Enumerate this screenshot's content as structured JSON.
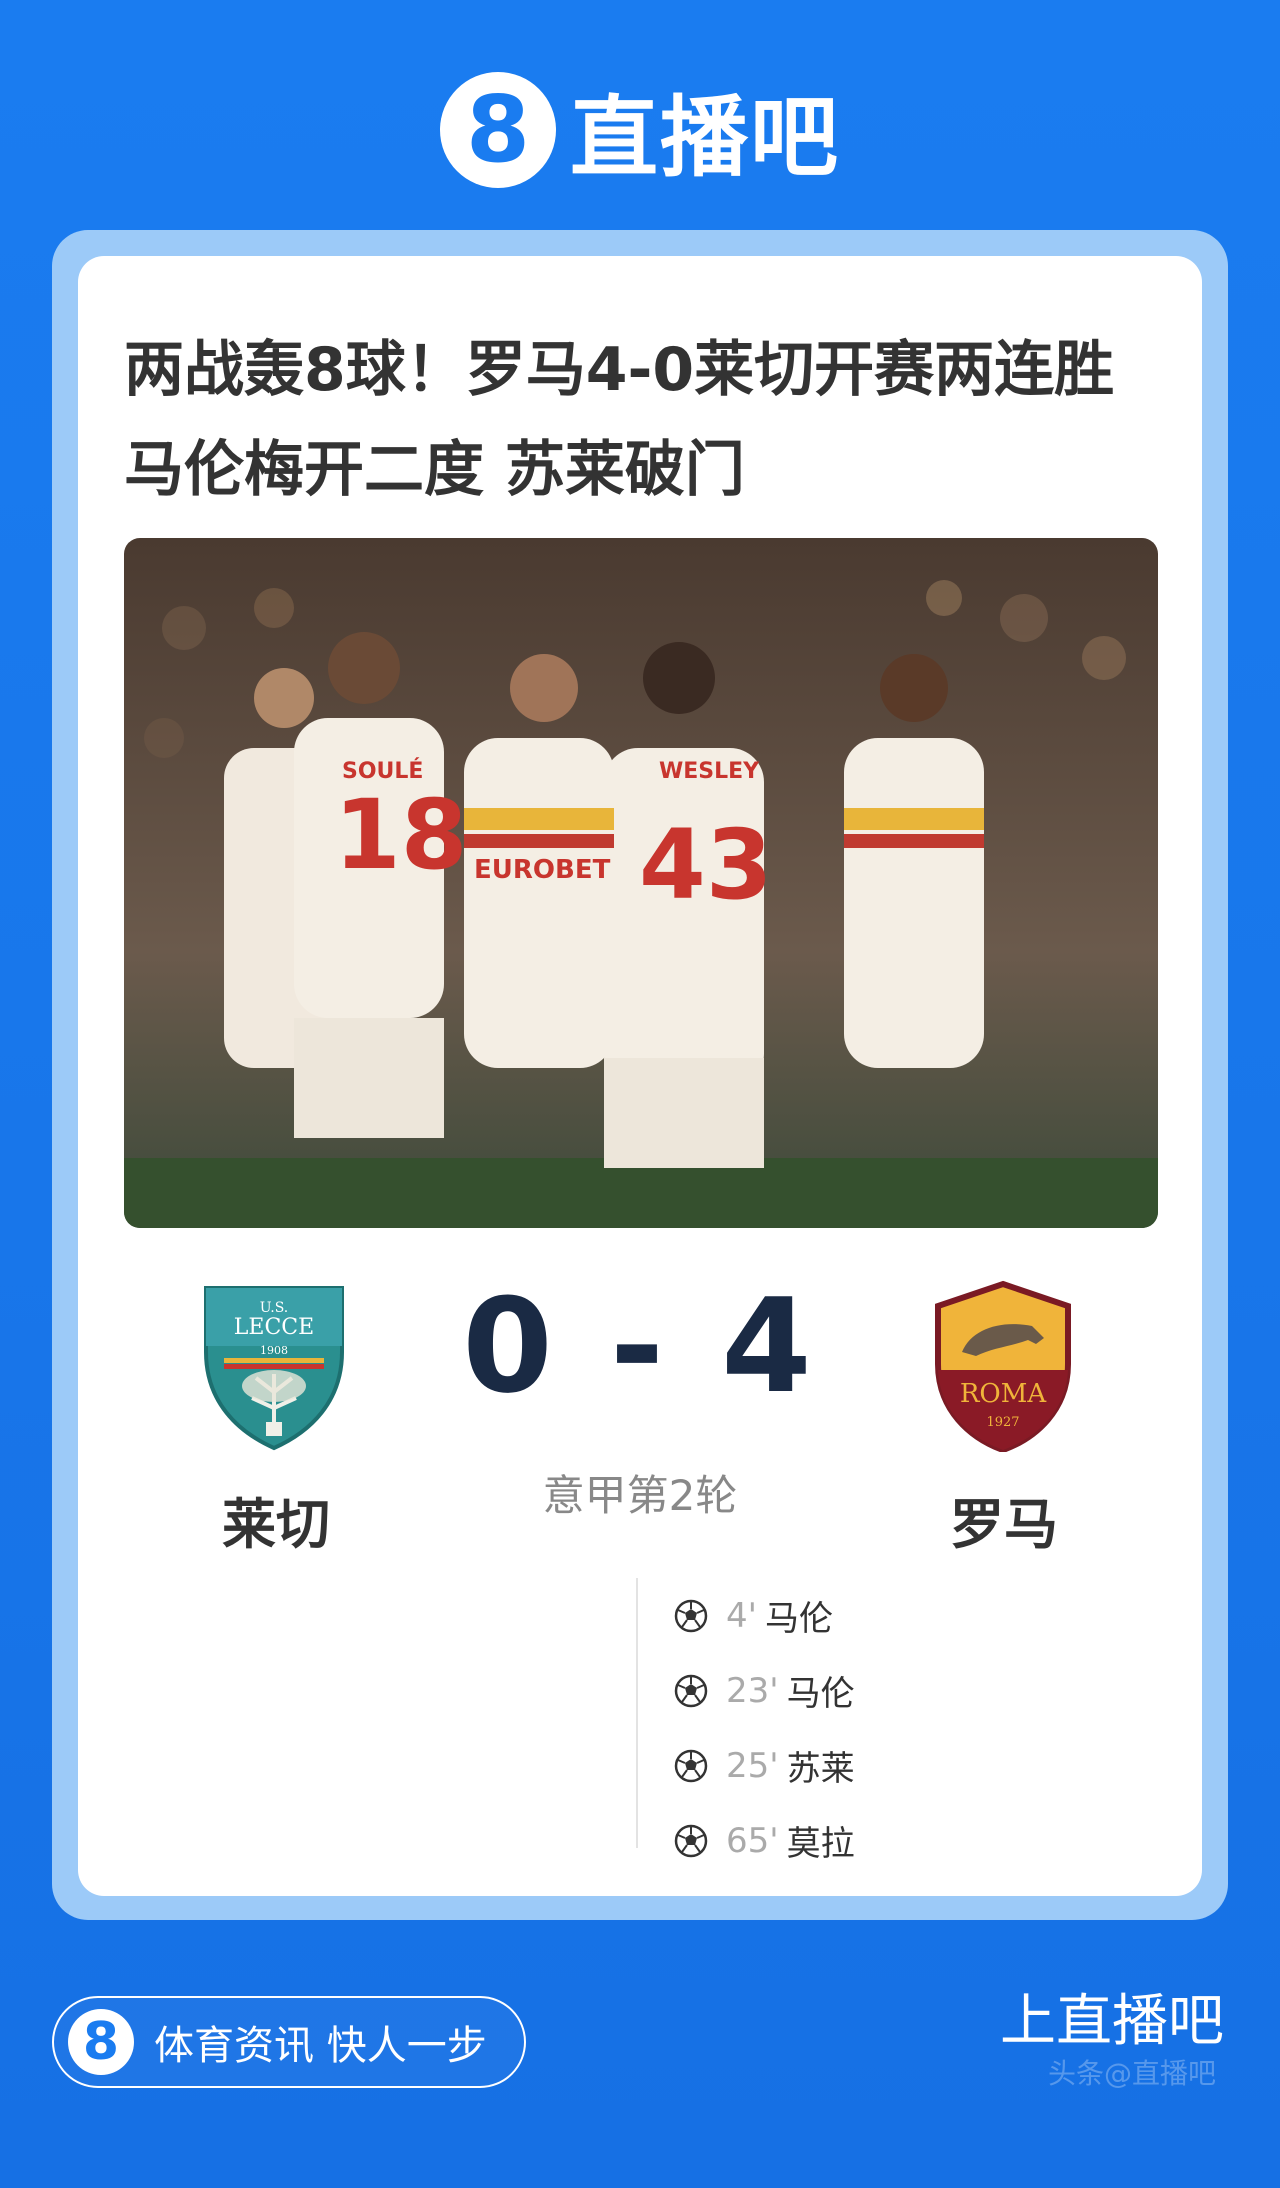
{
  "brand": {
    "logo_glyph": "8",
    "name": "直播吧"
  },
  "headline": {
    "line1": "两战轰8球！罗马4-0莱切开赛两连胜",
    "line2": "马伦梅开二度 苏莱破门"
  },
  "match": {
    "home": {
      "name": "莱切",
      "crest_icon": "lecce-crest-icon",
      "crest_text": "U.S. LECCE",
      "crest_year": "1908"
    },
    "away": {
      "name": "罗马",
      "crest_icon": "roma-crest-icon",
      "crest_text": "ROMA",
      "crest_year": "1927"
    },
    "score": "0 - 4",
    "competition": "意甲第2轮",
    "goals": [
      {
        "minute": "4'",
        "scorer": "马伦"
      },
      {
        "minute": "23'",
        "scorer": "马伦"
      },
      {
        "minute": "25'",
        "scorer": "苏莱"
      },
      {
        "minute": "65'",
        "scorer": "莫拉"
      }
    ]
  },
  "photo": {
    "jersey_numbers": [
      "18",
      "43"
    ],
    "jersey_names": [
      "SOULÉ",
      "WESLEY"
    ],
    "sponsor": "EUROBET"
  },
  "footer": {
    "slogan_logo": "8",
    "slogan": "体育资讯 快人一步",
    "cta": "上直播吧",
    "watermark": "头条@直播吧"
  },
  "colors": {
    "primary": "#1a7cf0",
    "frame": "#9ccaf8",
    "score": "#1a2a44"
  }
}
